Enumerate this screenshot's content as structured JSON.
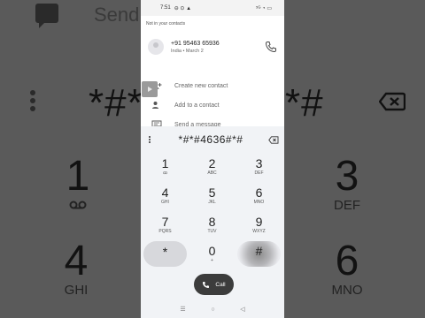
{
  "background": {
    "send_text": "Send",
    "big_number_left": "*#*",
    "big_number_right": "*#",
    "keys": [
      {
        "digit": "1",
        "letters": ""
      },
      {
        "digit": "3",
        "letters": "DEF"
      },
      {
        "digit": "4",
        "letters": "GHI"
      },
      {
        "digit": "6",
        "letters": "MNO"
      }
    ]
  },
  "status_bar": {
    "time": "7:51",
    "indicators": "⊖ ⊙ ▲",
    "right": "⁵ᴳ ◔ ▭"
  },
  "suggestion": {
    "header": "Not in your contacts",
    "number": "+91 95463 65936",
    "detail": "India • March 2"
  },
  "actions": [
    {
      "label": "Create new contact",
      "icon": "add-person-icon"
    },
    {
      "label": "Add to a contact",
      "icon": "person-plus-icon"
    },
    {
      "label": "Send a message",
      "icon": "message-icon"
    }
  ],
  "dialpad": {
    "entry": "*#*#4636#*#",
    "keys": [
      {
        "digit": "1",
        "letters": "ꝏ"
      },
      {
        "digit": "2",
        "letters": "ABC"
      },
      {
        "digit": "3",
        "letters": "DEF"
      },
      {
        "digit": "4",
        "letters": "GHI"
      },
      {
        "digit": "5",
        "letters": "JKL"
      },
      {
        "digit": "6",
        "letters": "MNO"
      },
      {
        "digit": "7",
        "letters": "PQRS"
      },
      {
        "digit": "8",
        "letters": "TUV"
      },
      {
        "digit": "9",
        "letters": "WXYZ"
      },
      {
        "digit": "*",
        "letters": ""
      },
      {
        "digit": "0",
        "letters": "+"
      },
      {
        "digit": "#",
        "letters": ""
      }
    ],
    "call_label": "Call"
  },
  "nav": {
    "menu": "☰",
    "home": "○",
    "back": "◁"
  },
  "colors": {
    "panel": "#ffffff",
    "dialpad": "#f1f3f6",
    "call_button": "#3c3c3c",
    "backdrop": "#5a5a5a"
  }
}
